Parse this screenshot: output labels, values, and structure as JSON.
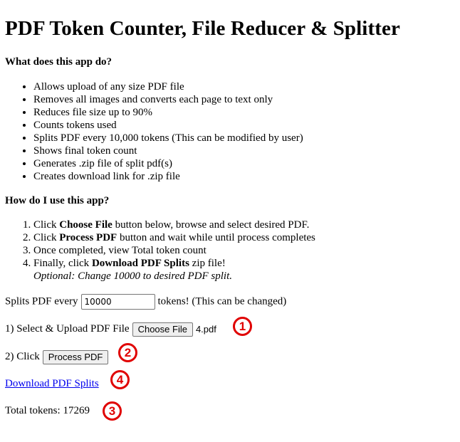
{
  "title": "PDF Token Counter, File Reducer & Splitter",
  "what_heading": "What does this app do?",
  "features": [
    "Allows upload of any size PDF file",
    "Removes all images and converts each page to text only",
    "Reduces file size up to 90%",
    "Counts tokens used",
    "Splits PDF every 10,000 tokens (This can be modified by user)",
    "Shows final token count",
    "Generates .zip file of split pdf(s)",
    "Creates download link for .zip file"
  ],
  "how_heading": "How do I use this app?",
  "steps": {
    "s1_pre": "Click ",
    "s1_bold": "Choose File",
    "s1_post": " button below, browse and select desired PDF.",
    "s2_pre": "Click ",
    "s2_bold": "Process PDF",
    "s2_post": " button and wait while until process completes",
    "s3": "Once completed, view Total token count",
    "s4_pre": "Finally, click ",
    "s4_bold": "Download PDF Splits",
    "s4_post": " zip file!",
    "optional": "Optional: Change 10000 to desired PDF split."
  },
  "split": {
    "pre": "Splits PDF every",
    "value": "10000",
    "post": "tokens! (This can be changed)"
  },
  "upload": {
    "label": "1) Select & Upload PDF File",
    "button": "Choose File",
    "filename": "4.pdf"
  },
  "process": {
    "label": "2) Click",
    "button": "Process PDF"
  },
  "download_link": "Download PDF Splits",
  "total": {
    "label": "Total tokens:",
    "value": "17269"
  },
  "markers": [
    "1",
    "2",
    "4",
    "3"
  ],
  "colors": {
    "marker": "#e00000",
    "link": "#0000ee"
  }
}
